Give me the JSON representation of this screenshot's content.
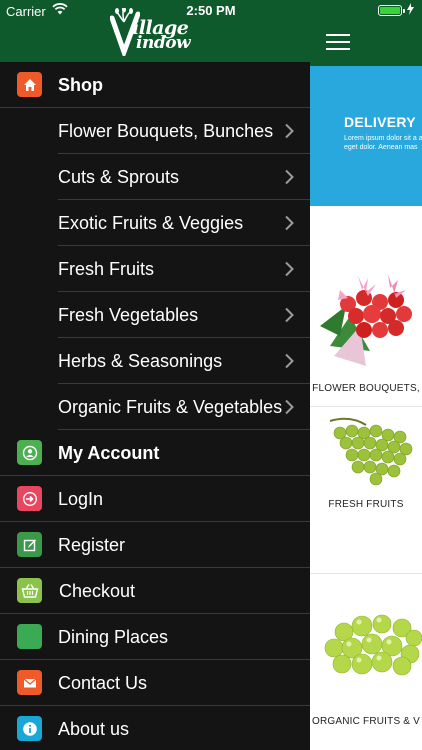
{
  "status_bar": {
    "carrier": "Carrier",
    "time": "2:50 PM"
  },
  "brand": {
    "line1": "illage",
    "line2": "indow"
  },
  "menu": [
    {
      "label": "Shop",
      "type": "header",
      "icon": "home-icon",
      "color": "#f05a28"
    },
    {
      "label": "Flower Bouquets, Bunches",
      "type": "sub"
    },
    {
      "label": "Cuts & Sprouts",
      "type": "sub"
    },
    {
      "label": "Exotic Fruits & Veggies",
      "type": "sub"
    },
    {
      "label": "Fresh Fruits",
      "type": "sub"
    },
    {
      "label": "Fresh Vegetables",
      "type": "sub"
    },
    {
      "label": "Herbs & Seasonings",
      "type": "sub"
    },
    {
      "label": "Organic Fruits & Vegetables",
      "type": "sub"
    },
    {
      "label": "My Account",
      "type": "header",
      "icon": "user-icon",
      "color": "#4caf50"
    },
    {
      "label": "LogIn",
      "type": "link",
      "icon": "login-icon",
      "color": "#e8475f"
    },
    {
      "label": "Register",
      "type": "link",
      "icon": "register-icon",
      "color": "#3a9a4a"
    },
    {
      "label": "Checkout",
      "type": "link",
      "icon": "basket-icon",
      "color": "#8bc34a"
    },
    {
      "label": "Dining Places",
      "type": "link",
      "icon": "dining-icon",
      "color": "#3aaa55"
    },
    {
      "label": "Contact Us",
      "type": "link",
      "icon": "mail-icon",
      "color": "#f05a28"
    },
    {
      "label": "About us",
      "type": "link",
      "icon": "info-icon",
      "color": "#19a7d8"
    }
  ],
  "banner": {
    "title": "DELIVERY",
    "body": "Lorem ipsum dolor sit a adipiscing elit.Aenean c eget dolor. Aenean mas"
  },
  "categories": [
    {
      "caption": "FLOWER BOUQUETS,",
      "image": "flower-bouquet-image"
    },
    {
      "caption": "FRESH FRUITS",
      "image": "green-grapes-image"
    },
    {
      "caption": "ORGANIC FRUITS & V",
      "image": "organic-grapes-image"
    }
  ],
  "colors": {
    "header_green": "#0e5a2c",
    "drawer_bg": "#141414",
    "banner_blue": "#29a8dd"
  }
}
